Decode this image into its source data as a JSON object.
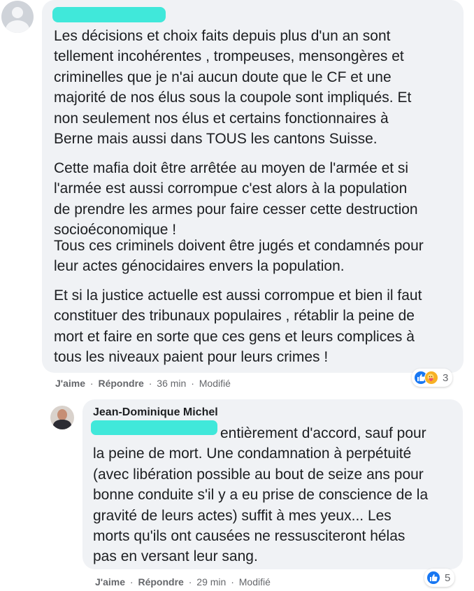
{
  "comments": [
    {
      "paragraphs": [
        [
          "Les décisions et choix faits depuis plus d'un an sont",
          "tellement incohérentes , trompeuses, mensongères et",
          "criminelles que je n'ai aucun doute que le CF et une",
          "majorité de nos élus sous la coupole sont impliqués. Et",
          "non seulement nos élus et certains fonctionnaires à",
          "Berne mais aussi dans TOUS les cantons Suisse."
        ],
        [
          "Cette mafia doit être arrêtée au moyen de l'armée et si",
          "l'armée est aussi corrompue c'est alors à la population",
          "de prendre les armes pour faire cesser cette destruction",
          "socioéconomique !"
        ],
        [
          "Tous ces criminels doivent être jugés et condamnés pour",
          "leur actes génocidaires envers la population."
        ],
        [
          "Et si la justice actuelle est aussi corrompue et bien il faut",
          "constituer des tribunaux populaires , rétablir la peine de",
          "mort et faire en sorte que ces gens et leurs complices à",
          "tous les niveaux paient pour leurs crimes !"
        ]
      ],
      "actions": {
        "like": "J'aime",
        "reply": "Répondre",
        "separator": "·",
        "time": "36 min",
        "status": "Modifié"
      },
      "reactions": {
        "icons": [
          "like-icon",
          "care-icon"
        ],
        "count": "3"
      }
    },
    {
      "author": "Jean-Dominique Michel",
      "lines": [
        "entièrement d'accord, sauf pour",
        "la peine de mort. Une condamnation à perpétuité",
        "(avec libération possible au bout de seize ans pour",
        "bonne conduite s'il y a eu prise de conscience de la",
        "gravité de leurs actes) suffit à mes yeux... Les",
        "morts qu'ils ont causées ne ressusciteront hélas",
        "pas en versant leur sang."
      ],
      "actions": {
        "like": "J'aime",
        "reply": "Répondre",
        "separator": "·",
        "time": "29 min",
        "status": "Modifié"
      },
      "reactions": {
        "icons": [
          "like-icon"
        ],
        "count": "5"
      }
    }
  ],
  "colors": {
    "bubble": "#f0f2f5",
    "text": "#1c1e21",
    "meta": "#65676b",
    "like": "#1877f2",
    "care": "#f7b125",
    "redaction": "#40e8da"
  }
}
